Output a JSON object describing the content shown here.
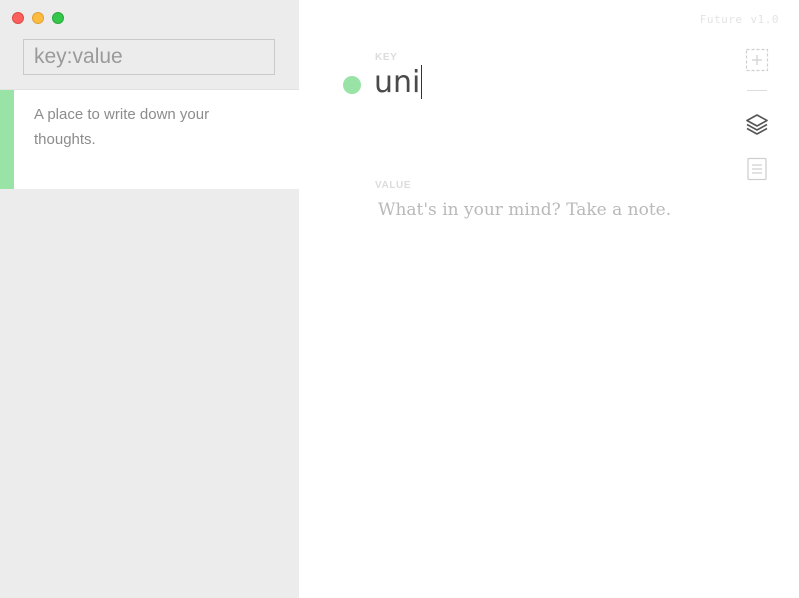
{
  "window": {
    "traffic_lights": [
      "close",
      "minimize",
      "zoom"
    ],
    "colors": {
      "close": "#fc605c",
      "minimize": "#fdbc40",
      "zoom": "#34c84a"
    }
  },
  "sidebar": {
    "search": {
      "placeholder": "key:value",
      "value": ""
    },
    "notes": [
      {
        "text": "A place to write down your thoughts.",
        "accent_color": "#98e3a5"
      }
    ]
  },
  "app": {
    "name": "Future",
    "version": "v1.0"
  },
  "editor": {
    "key_label": "KEY",
    "key_value": "uni",
    "value_label": "VALUE",
    "value_placeholder": "What's in your mind? Take a note.",
    "status_color": "#98e3a5"
  },
  "toolbar": {
    "items": [
      {
        "icon": "add-note-icon"
      },
      {
        "icon": "layers-icon"
      },
      {
        "icon": "document-icon"
      }
    ]
  }
}
